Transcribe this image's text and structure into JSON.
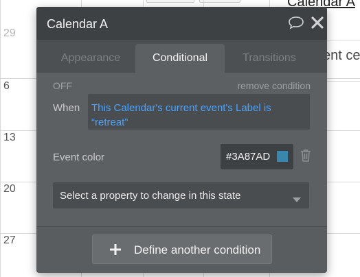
{
  "calendar": {
    "day_numbers": [
      "29",
      "6",
      "13",
      "20",
      "27"
    ],
    "right_title": "Calendar A",
    "right_snippet": "ent ce"
  },
  "panel": {
    "title": "Calendar A",
    "tabs": [
      {
        "label": "Appearance",
        "active": false
      },
      {
        "label": "Conditional",
        "active": true
      },
      {
        "label": "Transitions",
        "active": false
      }
    ],
    "condition": {
      "state_label": "OFF",
      "remove_label": "remove condition",
      "when_label": "When",
      "expression": "This Calendar's current event's Label is “retreat”"
    },
    "property": {
      "label": "Event color",
      "value": "#3A87AD",
      "swatch_color": "#3A87AD"
    },
    "select_property_placeholder": "Select a property to change in this state",
    "define_button_label": "Define another condition"
  },
  "icons": {
    "comment": "comment-icon",
    "close": "close-icon",
    "trash": "trash-icon",
    "dropdown": "chevron-down-icon",
    "plus": "plus-icon"
  },
  "colors": {
    "panel_bg": "#5d6062",
    "header_bg": "#3e4143",
    "link_blue": "#4aa3ff",
    "event_color": "#3A87AD"
  }
}
